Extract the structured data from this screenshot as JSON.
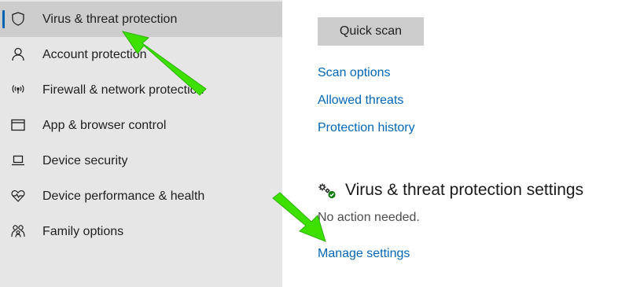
{
  "sidebar": {
    "items": [
      {
        "label": "Virus & threat protection",
        "icon": "shield-icon",
        "active": true
      },
      {
        "label": "Account protection",
        "icon": "person-icon",
        "active": false
      },
      {
        "label": "Firewall & network protection",
        "icon": "wifi-signal-icon",
        "active": false
      },
      {
        "label": "App & browser control",
        "icon": "app-window-icon",
        "active": false
      },
      {
        "label": "Device security",
        "icon": "laptop-icon",
        "active": false
      },
      {
        "label": "Device performance & health",
        "icon": "heart-pulse-icon",
        "active": false
      },
      {
        "label": "Family options",
        "icon": "family-icon",
        "active": false
      }
    ]
  },
  "main": {
    "quick_scan_label": "Quick scan",
    "links": {
      "scan_options": "Scan options",
      "allowed_threats": "Allowed threats",
      "protection_history": "Protection history"
    },
    "settings_section": {
      "icon": "gears-check-icon",
      "title": "Virus & threat protection settings",
      "status": "No action needed.",
      "manage_link": "Manage settings"
    }
  },
  "annotations": {
    "arrow_color": "#3ee000",
    "arrows": [
      "annotation-arrow-to-sidebar-item",
      "annotation-arrow-to-manage-settings"
    ]
  },
  "colors": {
    "accent": "#0063b1",
    "link": "#0067b8",
    "sidebar_bg": "#e6e6e6",
    "sidebar_active_bg": "#cdcdcd",
    "button_bg": "#cccccc",
    "status_ok": "#107c10"
  }
}
